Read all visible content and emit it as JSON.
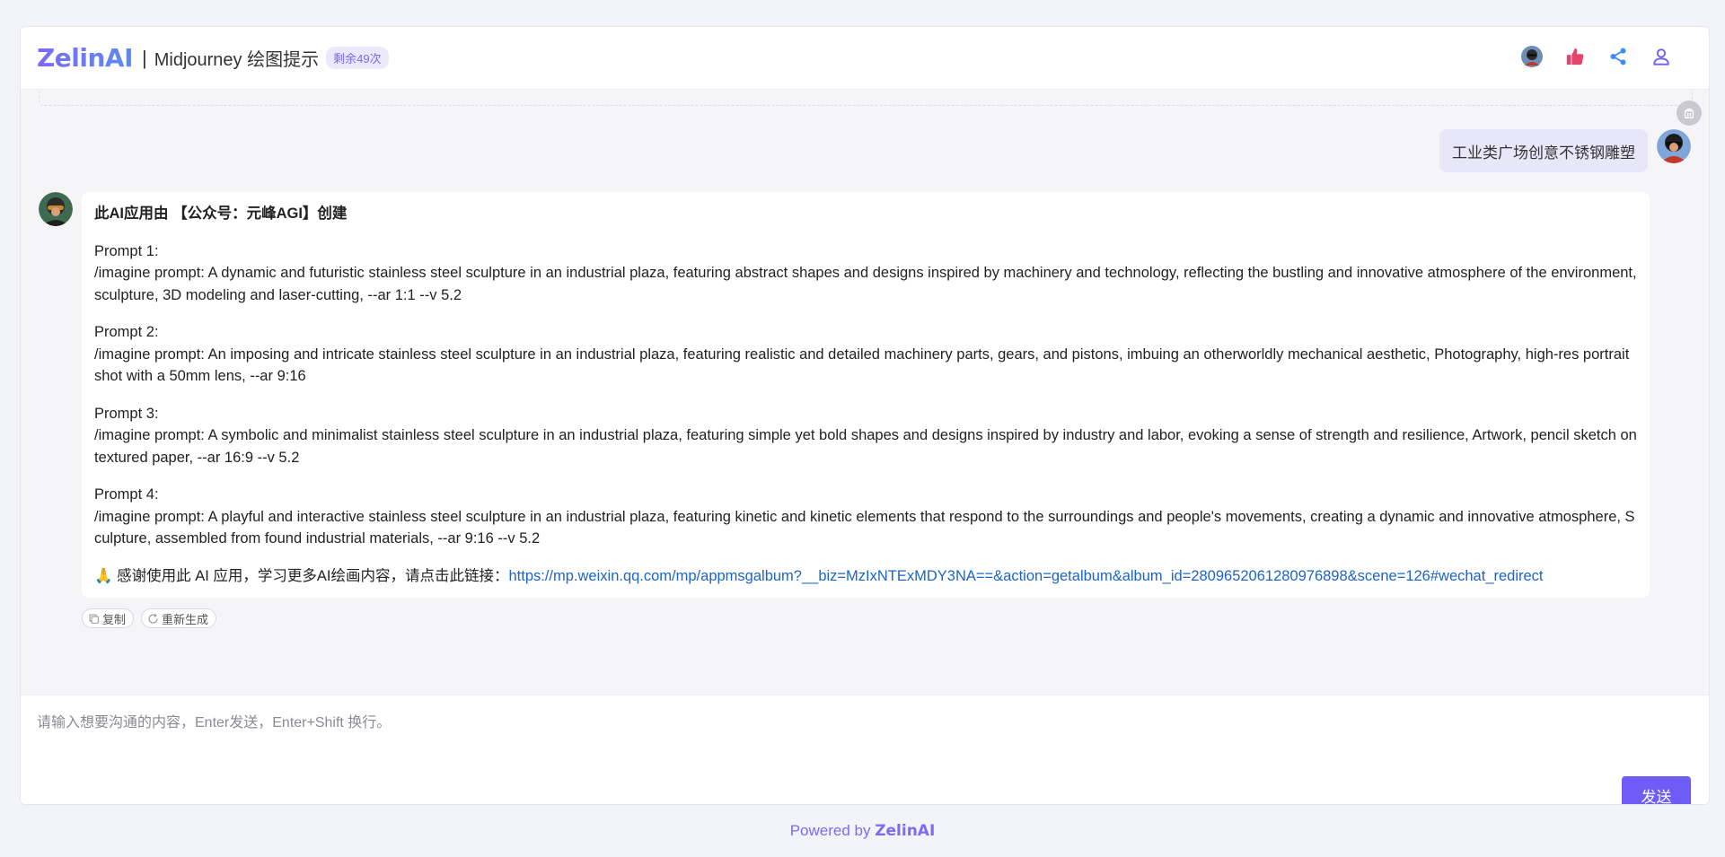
{
  "header": {
    "logo": "ZelinAI",
    "separator": "|",
    "title": "Midjourney 绘图提示",
    "quota_badge": "剩余49次",
    "actions": [
      {
        "icon": "avatar-icon"
      },
      {
        "icon": "thumbs-up-icon"
      },
      {
        "icon": "share-icon"
      },
      {
        "icon": "user-icon"
      }
    ]
  },
  "user_message": {
    "text": "工业类广场创意不锈钢雕塑"
  },
  "bot_message": {
    "heading": "此AI应用由 【公众号：元峰AGI】创建",
    "prompts": [
      {
        "label": "Prompt 1:",
        "text": "/imagine prompt: A dynamic and futuristic stainless steel sculpture in an industrial plaza, featuring abstract shapes and designs inspired by machinery and technology, reflecting the bustling and innovative atmosphere of the environment, sculpture, 3D modeling and laser-cutting, --ar 1:1 --v 5.2"
      },
      {
        "label": "Prompt 2:",
        "text": "/imagine prompt: An imposing and intricate stainless steel sculpture in an industrial plaza, featuring realistic and detailed machinery parts, gears, and pistons, imbuing an otherworldly mechanical aesthetic, Photography, high-res portrait shot with a 50mm lens, --ar 9:16"
      },
      {
        "label": "Prompt 3:",
        "text": "/imagine prompt: A symbolic and minimalist stainless steel sculpture in an industrial plaza, featuring simple yet bold shapes and designs inspired by industry and labor, evoking a sense of strength and resilience, Artwork, pencil sketch on textured paper, --ar 16:9 --v 5.2"
      },
      {
        "label": "Prompt 4:",
        "text": "/imagine prompt: A playful and interactive stainless steel sculpture in an industrial plaza, featuring kinetic and kinetic elements that respond to the surroundings and people's movements, creating a dynamic and innovative atmosphere, Sculpture, assembled from found industrial materials, --ar 9:16 --v 5.2"
      }
    ],
    "thanks_emoji": "🙏",
    "thanks_text": " 感谢使用此 AI 应用，学习更多AI绘画内容，请点击此链接：",
    "link": "https://mp.weixin.qq.com/mp/appmsgalbum?__biz=MzIxNTExMDY3NA==&action=getalbum&album_id=2809652061280976898&scene=126#wechat_redirect"
  },
  "message_actions": {
    "copy_label": "复制",
    "regenerate_label": "重新生成"
  },
  "composer": {
    "placeholder": "请输入想要沟通的内容，Enter发送，Enter+Shift 换行。",
    "value": "",
    "send_label": "发送"
  },
  "footer": {
    "prefix": "Powered by ",
    "brand": "ZelinAI"
  },
  "colors": {
    "accent": "#6d5cf5",
    "link": "#1c64c8",
    "user_bubble": "#e8e6f9",
    "badge_bg": "#ece9fd",
    "like": "#e8436a",
    "share": "#3f8df0"
  }
}
